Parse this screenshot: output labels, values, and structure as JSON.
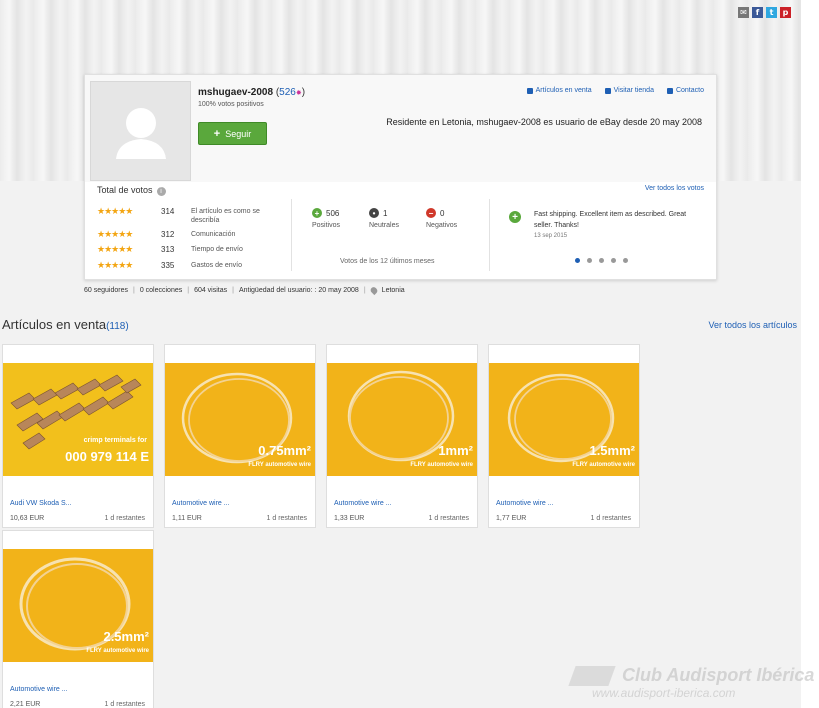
{
  "profile": {
    "username": "mshugaev-2008",
    "feedback_score": "526",
    "positive_pct": "100% votos positivos",
    "follow_label": "Seguir",
    "resident_text": "Residente en Letonia, mshugaev-2008 es usuario de eBay desde 20 may 2008",
    "links": [
      "Artículos en venta",
      "Visitar tienda",
      "Contacto"
    ]
  },
  "votes": {
    "title": "Total de votos",
    "see_all": "Ver todos los votos",
    "details": [
      {
        "value": "314",
        "label": "El artículo es como se describía",
        "stars": 5
      },
      {
        "value": "312",
        "label": "Comunicación",
        "stars": 5
      },
      {
        "value": "313",
        "label": "Tiempo de envío",
        "stars": 5
      },
      {
        "value": "335",
        "label": "Gastos de envío",
        "stars": 5
      }
    ],
    "positive": {
      "count": "506",
      "label": "Positivos"
    },
    "neutral": {
      "count": "1",
      "label": "Neutrales"
    },
    "negative": {
      "count": "0",
      "label": "Negativos"
    },
    "period": "Votos de los 12 últimos meses",
    "comment": "Fast shipping. Excellent item as described. Great seller. Thanks!",
    "comment_date": "13 sep 2015"
  },
  "stats": {
    "followers": "60 seguidores",
    "collections": "0 colecciones",
    "visits": "604 visitas",
    "member_since": "Antigüedad del usuario: : 20 may 2008",
    "location": "Letonia"
  },
  "listings": {
    "title": "Artículos en venta",
    "count": "(118)",
    "see_all": "Ver todos los artículos",
    "items": [
      {
        "title": "Audi VW Skoda S...",
        "price": "10,63 EUR",
        "time_left": "1 d restantes",
        "img_text_1": "crimp terminals for",
        "img_text_2": "000 979 114 E"
      },
      {
        "title": "Automotive wire ...",
        "price": "1,11 EUR",
        "time_left": "1 d restantes",
        "img_text_1": "0.75mm²",
        "img_text_2": "FLRY automotive wire"
      },
      {
        "title": "Automotive wire ...",
        "price": "1,33 EUR",
        "time_left": "1 d restantes",
        "img_text_1": "1mm²",
        "img_text_2": "FLRY automotive wire"
      },
      {
        "title": "Automotive wire ...",
        "price": "1,77 EUR",
        "time_left": "1 d restantes",
        "img_text_1": "1.5mm²",
        "img_text_2": "FLRY automotive wire"
      },
      {
        "title": "Automotive wire ...",
        "price": "2,21 EUR",
        "time_left": "1 d restantes",
        "img_text_1": "2.5mm²",
        "img_text_2": "FLRY automotive wire"
      }
    ]
  },
  "watermark": {
    "line1": "Club Audisport Ibérica",
    "line2": "www.audisport-iberica.com"
  },
  "colors": {
    "accent": "#1e5fb4",
    "follow_green": "#5aa83c",
    "star": "#f3a512",
    "wire_bg": "#f2b319"
  }
}
